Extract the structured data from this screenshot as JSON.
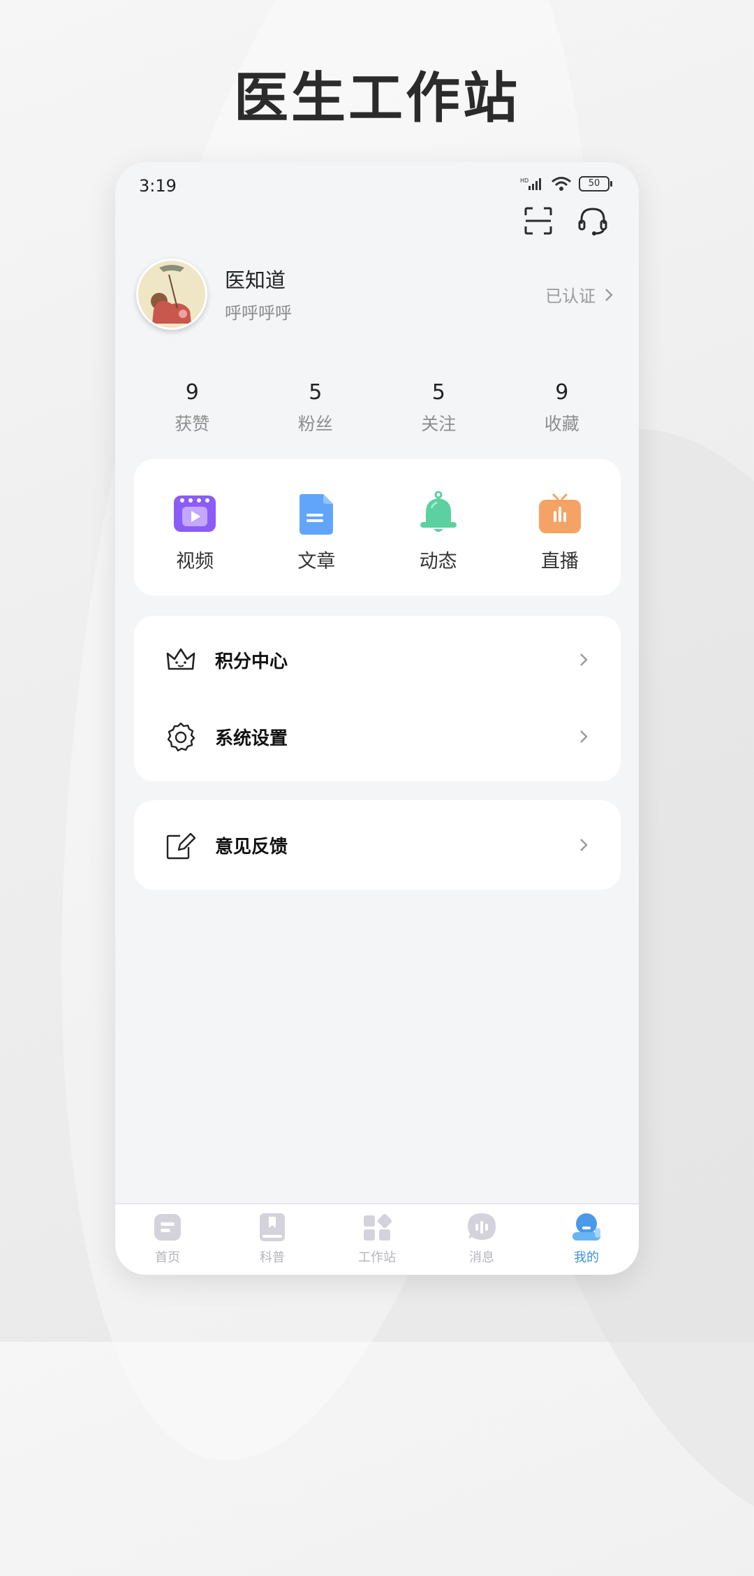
{
  "page_title": "医生工作站",
  "status_bar": {
    "time": "3:19",
    "battery": "50"
  },
  "profile": {
    "name": "医知道",
    "subtitle": "呼呼呼呼",
    "verified_label": "已认证"
  },
  "stats": [
    {
      "value": "9",
      "label": "获赞"
    },
    {
      "value": "5",
      "label": "粉丝"
    },
    {
      "value": "5",
      "label": "关注"
    },
    {
      "value": "9",
      "label": "收藏"
    }
  ],
  "features": [
    {
      "label": "视频",
      "icon": "video-icon",
      "color": "#8b5cf6"
    },
    {
      "label": "文章",
      "icon": "document-icon",
      "color": "#60a5fa"
    },
    {
      "label": "动态",
      "icon": "bell-icon",
      "color": "#5cd0a0"
    },
    {
      "label": "直播",
      "icon": "live-tv-icon",
      "color": "#f5a365"
    }
  ],
  "menu": {
    "points_center": "积分中心",
    "system_settings": "系统设置",
    "feedback": "意见反馈"
  },
  "tabs": [
    {
      "label": "首页",
      "icon": "home-icon"
    },
    {
      "label": "科普",
      "icon": "book-icon"
    },
    {
      "label": "工作站",
      "icon": "workstation-icon"
    },
    {
      "label": "消息",
      "icon": "message-icon"
    },
    {
      "label": "我的",
      "icon": "profile-icon",
      "active": true
    }
  ],
  "colors": {
    "active_tab": "#3a8fe0",
    "inactive_tab": "#b4b4bc"
  }
}
